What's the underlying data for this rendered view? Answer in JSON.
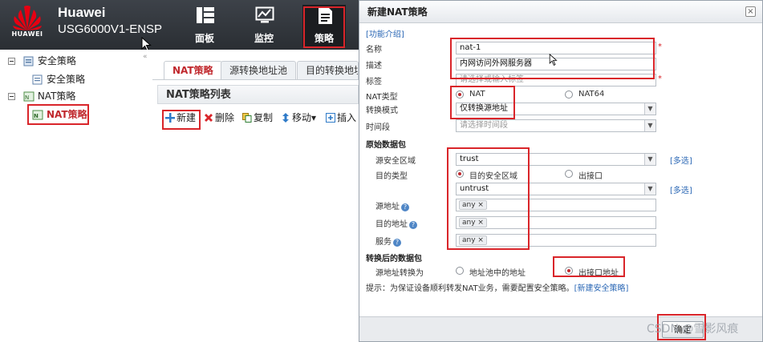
{
  "header": {
    "brand": "Huawei",
    "model": "USG6000V1-ENSP",
    "logo_text": "HUAWEI",
    "nav": [
      {
        "label": "面板",
        "icon": "dashboard-icon"
      },
      {
        "label": "监控",
        "icon": "monitor-icon"
      },
      {
        "label": "策略",
        "icon": "policy-icon"
      }
    ]
  },
  "tree": {
    "items": [
      {
        "label": "安全策略",
        "icon": "security-policy-icon"
      },
      {
        "label": "安全策略",
        "icon": "policy-doc-icon"
      },
      {
        "label": "NAT策略",
        "icon": "nat-icon"
      },
      {
        "label": "NAT策略",
        "icon": "nat-icon"
      }
    ]
  },
  "tabs": [
    {
      "label": "NAT策略"
    },
    {
      "label": "源转换地址池"
    },
    {
      "label": "目的转换地址"
    }
  ],
  "list": {
    "title": "NAT策略列表",
    "toolbar": [
      {
        "label": "新建",
        "icon": "plus-icon"
      },
      {
        "label": "删除",
        "icon": "delete-icon"
      },
      {
        "label": "复制",
        "icon": "copy-icon"
      },
      {
        "label": "移动▾",
        "icon": "move-icon"
      },
      {
        "label": "插入",
        "icon": "insert-icon"
      }
    ]
  },
  "dialog": {
    "title": "新建NAT策略",
    "help_link": "[功能介绍]",
    "name_label": "名称",
    "name_value": "nat-1",
    "desc_label": "描述",
    "desc_value": "内网访问外网服务器",
    "tag_label": "标签",
    "tag_placeholder": "请选择或输入标签",
    "nat_type_label": "NAT类型",
    "nat_type_options": [
      "NAT",
      "NAT64"
    ],
    "nat_type_selected": "NAT",
    "mode_label": "转换模式",
    "mode_value": "仅转换源地址",
    "time_label": "时间段",
    "time_placeholder": "请选择时间段",
    "orig_section": "原始数据包",
    "src_zone_label": "源安全区域",
    "src_zone_value": "trust",
    "multi_select": "[多选]",
    "dst_type_label": "目的类型",
    "dst_type_options": [
      "目的安全区域",
      "出接口"
    ],
    "dst_type_selected": "目的安全区域",
    "dst_zone_value": "untrust",
    "src_addr_label": "源地址",
    "dst_addr_label": "目的地址",
    "service_label": "服务",
    "any_tag": "any",
    "trans_section": "转换后的数据包",
    "src_trans_label": "源地址转换为",
    "src_trans_options": [
      "地址池中的地址",
      "出接口地址"
    ],
    "src_trans_selected": "出接口地址",
    "tip": "提示：为保证设备顺利转发NAT业务，需要配置安全策略。",
    "tip_link": "[新建安全策略]",
    "ok_label": "确定",
    "required_mark": "*"
  },
  "watermark": "CSDN @雪影风痕",
  "colors": {
    "header_bg": "#2f3338",
    "accent_red": "#d9252a",
    "link_blue": "#2a67b5"
  }
}
